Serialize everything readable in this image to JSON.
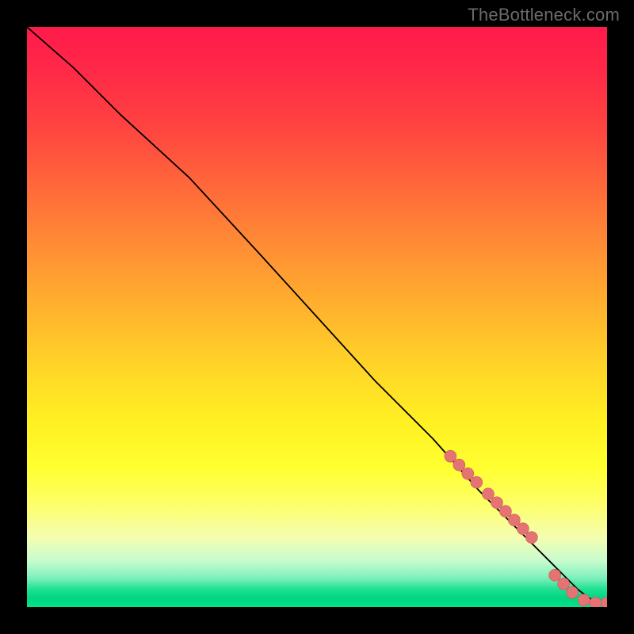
{
  "watermark": "TheBottleneck.com",
  "colors": {
    "background": "#000000",
    "gradient_top": "#ff1a4b",
    "gradient_mid": "#fff022",
    "gradient_green": "#00e58a",
    "curve": "#000000",
    "marker_fill": "#e57373",
    "marker_stroke": "#c65a5a"
  },
  "chart_data": {
    "type": "line",
    "title": "",
    "xlabel": "",
    "ylabel": "",
    "xlim": [
      0,
      100
    ],
    "ylim": [
      0,
      100
    ],
    "grid": false,
    "legend": false,
    "description": "A single curve starting near the top-left, descending with a slope change around x≈28, continuing as a near-linear diagonal to the lower-right, with a dense cluster of markers near the end and a final flattening near y≈0.",
    "series": [
      {
        "name": "curve",
        "kind": "line",
        "x": [
          0,
          8,
          16,
          28,
          40,
          50,
          60,
          70,
          78,
          86,
          90,
          93,
          95,
          97,
          99,
          100
        ],
        "y": [
          100,
          93,
          85,
          74,
          61,
          50,
          39,
          29,
          20,
          12,
          8,
          5,
          3,
          1.5,
          0.7,
          0.7
        ]
      },
      {
        "name": "markers",
        "kind": "scatter",
        "x": [
          73,
          74.5,
          76,
          77.5,
          79.5,
          81,
          82.5,
          84,
          85.5,
          87,
          91,
          92.5,
          94,
          96,
          98,
          100
        ],
        "y": [
          26,
          24.5,
          23,
          21.5,
          19.5,
          18,
          16.5,
          15,
          13.5,
          12,
          5.5,
          4,
          2.5,
          1.2,
          0.7,
          0.7
        ]
      }
    ]
  }
}
